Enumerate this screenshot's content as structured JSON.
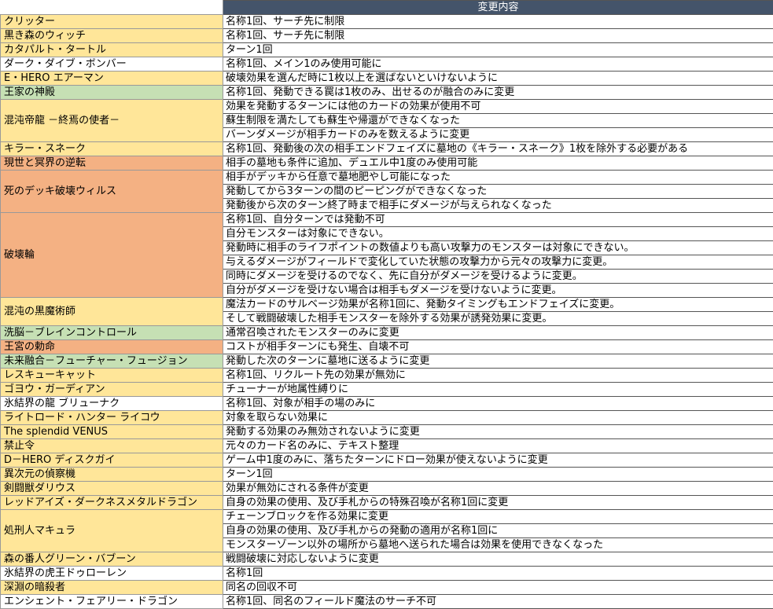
{
  "header": {
    "column2": "変更内容"
  },
  "colors": {
    "yellow": "#ffe699",
    "green": "#c6e0b4",
    "orange": "#f4b183",
    "header": "#44546a"
  },
  "rows": [
    {
      "name": "クリッター",
      "color": "yellow",
      "lines": [
        "名称1回、サーチ先に制限"
      ]
    },
    {
      "name": "黒き森のウィッチ",
      "color": "yellow",
      "lines": [
        "名称1回、サーチ先に制限"
      ]
    },
    {
      "name": "カタパルト・タートル",
      "color": "yellow",
      "lines": [
        "ターン1回"
      ]
    },
    {
      "name": "ダーク・ダイブ・ボンバー",
      "color": "white",
      "lines": [
        "名称1回、メイン1のみ使用可能に"
      ]
    },
    {
      "name": "E・HERO エアーマン",
      "color": "yellow",
      "lines": [
        "破壊効果を選んだ時に1枚以上を選ばないといけないように"
      ]
    },
    {
      "name": "王家の神殿",
      "color": "green",
      "lines": [
        "名称1回、発動できる罠は1枚のみ、出せるのが融合のみに変更"
      ]
    },
    {
      "name": "混沌帝龍 －終焉の使者－",
      "color": "yellow",
      "lines": [
        "効果を発動するターンには他のカードの効果が使用不可",
        "蘇生制限を満たしても蘇生や帰還ができなくなった",
        "バーンダメージが相手カードのみを数えるように変更"
      ]
    },
    {
      "name": "キラー・スネーク",
      "color": "yellow",
      "lines": [
        "名称1回、発動後の次の相手エンドフェイズに墓地の《キラー・スネーク》1枚を除外する必要がある"
      ]
    },
    {
      "name": "現世と冥界の逆転",
      "color": "orange",
      "lines": [
        "相手の墓地も条件に追加、デュエル中1度のみ使用可能"
      ]
    },
    {
      "name": "死のデッキ破壊ウィルス",
      "color": "orange",
      "lines": [
        "相手がデッキから任意で墓地肥やし可能になった",
        "発動してから3ターンの間のピーピングができなくなった",
        "発動後から次のターン終了時まで相手にダメージが与えられなくなった"
      ]
    },
    {
      "name": "破壊輪",
      "color": "orange",
      "lines": [
        "名称1回、自分ターンでは発動不可",
        "自分モンスターは対象にできない。",
        "発動時に相手のライフポイントの数値よりも高い攻撃力のモンスターは対象にできない。",
        "与えるダメージがフィールドで変化していた状態の攻撃力から元々の攻撃力に変更。",
        "同時にダメージを受けるのでなく、先に自分がダメージを受けるように変更。",
        "自分がダメージを受けない場合は相手もダメージを受けないように変更。"
      ]
    },
    {
      "name": "混沌の黒魔術師",
      "color": "yellow",
      "lines": [
        "魔法カードのサルベージ効果が名称1回に、発動タイミングもエンドフェイズに変更。",
        "そして戦闘破壊した相手モンスターを除外する効果が誘発効果に変更。"
      ]
    },
    {
      "name": "洗脳－ブレインコントロール",
      "color": "green",
      "lines": [
        "通常召喚されたモンスターのみに変更"
      ]
    },
    {
      "name": "王宮の勅命",
      "color": "orange",
      "lines": [
        "コストが相手ターンにも発生、自壊不可"
      ]
    },
    {
      "name": "未来融合－フューチャー・フュージョン",
      "color": "green",
      "lines": [
        "発動した次のターンに墓地に送るように変更"
      ]
    },
    {
      "name": "レスキューキャット",
      "color": "yellow",
      "lines": [
        "名称1回、リクルート先の効果が無効に"
      ]
    },
    {
      "name": "ゴヨウ・ガーディアン",
      "color": "yellow",
      "lines": [
        "チューナーが地属性縛りに"
      ]
    },
    {
      "name": "氷結界の龍 ブリューナク",
      "color": "white",
      "lines": [
        "名称1回、対象が相手の場のみに"
      ]
    },
    {
      "name": "ライトロード・ハンター ライコウ",
      "color": "yellow",
      "lines": [
        "対象を取らない効果に"
      ]
    },
    {
      "name": "The splendid VENUS",
      "color": "yellow",
      "lines": [
        "発動する効果のみ無効されないように変更"
      ]
    },
    {
      "name": "禁止令",
      "color": "yellow",
      "lines": [
        "元々のカード名のみに、テキスト整理"
      ]
    },
    {
      "name": "D－HERO ディスクガイ",
      "color": "yellow",
      "lines": [
        "ゲーム中1度のみに、落ちたターンにドロー効果が使えないように変更"
      ]
    },
    {
      "name": "異次元の偵察機",
      "color": "yellow",
      "lines": [
        "ターン1回"
      ]
    },
    {
      "name": "剣闘獣ダリウス",
      "color": "yellow",
      "lines": [
        "効果が無効にされる条件が変更"
      ]
    },
    {
      "name": "レッドアイズ・ダークネスメタルドラゴン",
      "color": "yellow",
      "lines": [
        "自身の効果の使用、及び手札からの特殊召喚が名称1回に変更"
      ]
    },
    {
      "name": "処刑人マキュラ",
      "color": "yellow",
      "lines": [
        "チェーンブロックを作る効果に変更",
        "自身の効果の使用、及び手札からの発動の適用が名称1回に",
        "モンスターゾーン以外の場所から墓地へ送られた場合は効果を使用できなくなった"
      ]
    },
    {
      "name": "森の番人グリーン・バブーン",
      "color": "yellow",
      "lines": [
        "戦闘破壊に対応しないように変更"
      ]
    },
    {
      "name": "氷結界の虎王ドゥローレン",
      "color": "white",
      "lines": [
        "名称1回"
      ]
    },
    {
      "name": "深淵の暗殺者",
      "color": "yellow",
      "lines": [
        "同名の回収不可"
      ]
    },
    {
      "name": "エンシェント・フェアリー・ドラゴン",
      "color": "white",
      "lines": [
        "名称1回、同名のフィールド魔法のサーチ不可"
      ]
    }
  ]
}
